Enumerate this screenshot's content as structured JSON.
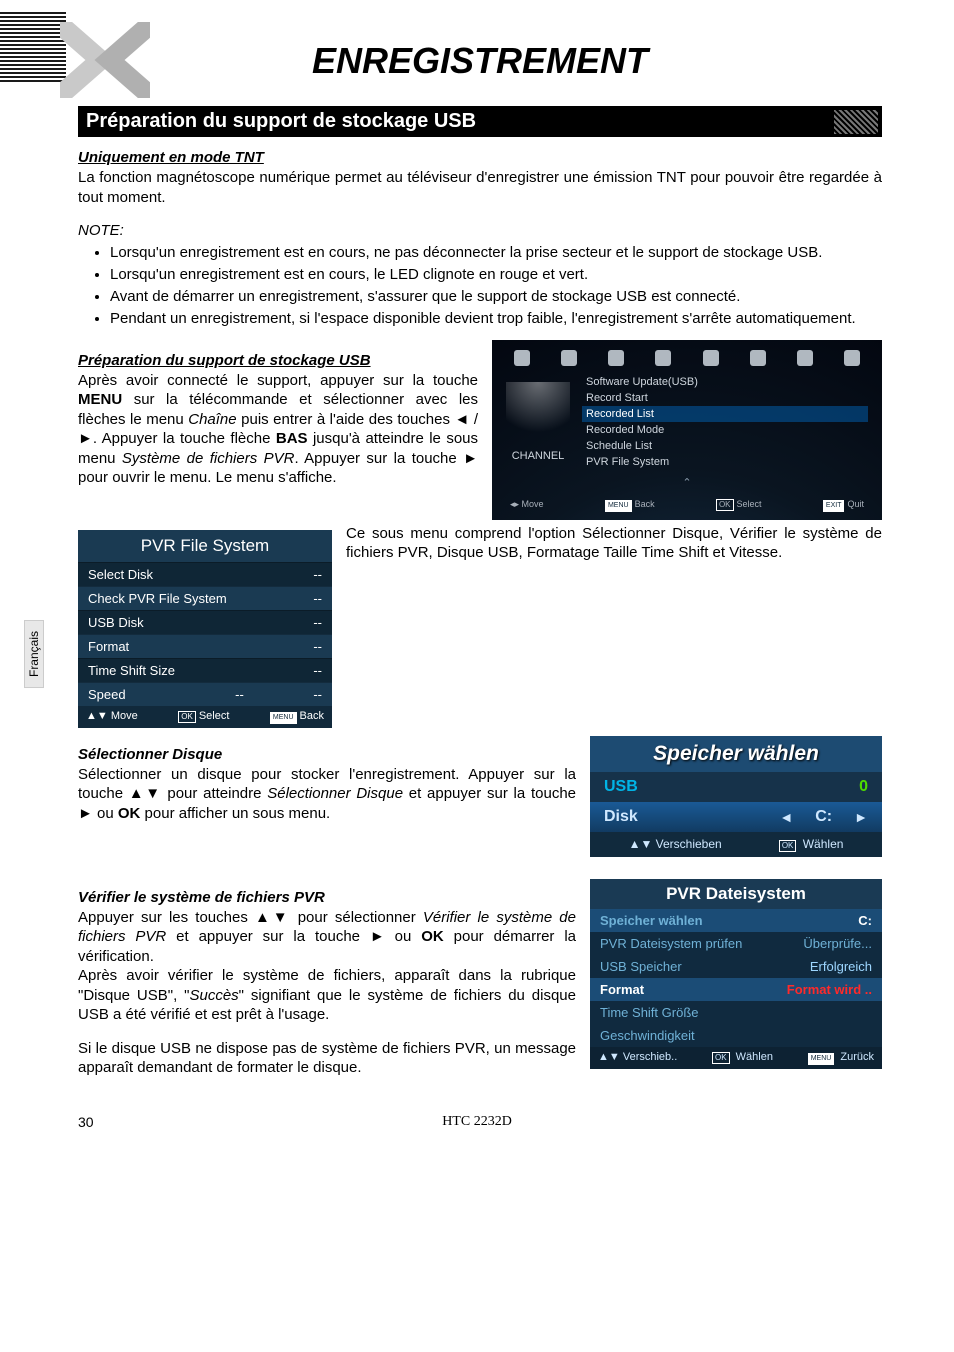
{
  "header": {
    "title": "ENREGISTREMENT"
  },
  "section": {
    "heading": "Préparation du support de stockage USB"
  },
  "side_tab": "Français",
  "sub1": {
    "heading": "Uniquement en mode TNT",
    "text": "La fonction magnétoscope numérique permet au téléviseur d'enregistrer une émission TNT pour pouvoir être regardée à tout moment."
  },
  "note_label": "NOTE:",
  "notes": [
    "Lorsqu'un enregistrement est en cours, ne pas déconnecter la prise secteur et le support de stockage USB.",
    "Lorsqu'un enregistrement est en cours, le LED clignote en rouge et vert.",
    "Avant de démarrer un enregistrement, s'assurer que le support de stockage USB est connecté.",
    "Pendant un enregistrement, si l'espace disponible devient trop faible, l'enregistrement s'arrête automatiquement."
  ],
  "prep": {
    "heading": "Préparation du support de stockage USB",
    "para_a": "Après avoir connecté le support, appuyer sur la touche ",
    "menu": "MENU",
    "para_b": " sur la télécommande et sélectionner avec les flèches le menu ",
    "chaine": "Chaîne",
    "para_c": " puis entrer à l'aide des touches ◄ / ►. Appuyer la touche flèche ",
    "bas": "BAS",
    "para_d": " jusqu'à atteindre le sous menu ",
    "syspvr": "Système de fichiers PVR",
    "para_e": ". Appuyer sur la touche ► pour ouvrir le menu. Le menu s'affiche."
  },
  "osd": {
    "channel": "CHANNEL",
    "items": [
      "Software Update(USB)",
      "Record Start",
      "Recorded List",
      "Recorded Mode",
      "Schedule List",
      "PVR File System"
    ],
    "highlight_index": 2,
    "footer": [
      "Move",
      "Back",
      "Select",
      "Quit"
    ]
  },
  "pvr_table": {
    "title": "PVR File System",
    "rows": [
      {
        "label": "Select Disk",
        "value": "--"
      },
      {
        "label": "Check PVR File System",
        "value": "--"
      },
      {
        "label": "USB Disk",
        "value": "--"
      },
      {
        "label": "Format",
        "value": "--"
      },
      {
        "label": "Time Shift Size",
        "value": "--"
      },
      {
        "label": "Speed",
        "value": "--"
      }
    ],
    "footer": {
      "move": "Move",
      "select": "Select",
      "back": "Back"
    }
  },
  "pvr_para": "Ce sous menu comprend l'option Sélectionner Disque, Vérifier le système de fichiers PVR, Disque USB, Formatage Taille Time Shift  et Vitesse.",
  "select_disk": {
    "heading": "Sélectionner Disque",
    "para_a": "Sélectionner un disque pour stocker l'enregistrement. Appuyer sur la touche ▲▼ pour atteindre ",
    "italic": "Sélectionner Disque",
    "para_b": " et appuyer sur la touche ► ou ",
    "ok": "OK",
    "para_c": " pour afficher un sous menu."
  },
  "speicher": {
    "title": "Speicher wählen",
    "usb_label": "USB",
    "usb_value": "0",
    "disk_label": "Disk",
    "disk_value": "C:",
    "footer_move": "Verschieben",
    "footer_select": "Wählen"
  },
  "verify": {
    "heading": "Vérifier le système de fichiers PVR",
    "para1_a": "Appuyer sur les touches ▲▼ pour sélectionner ",
    "para1_italic": "Vérifier le système de fichiers PVR",
    "para1_b": " et appuyer sur la touche ► ou ",
    "para1_ok": "OK",
    "para1_c": " pour démarrer la vérification.",
    "para2_a": "Après avoir vérifier le système de fichiers, apparaît dans la rubrique \"Disque USB\", \"",
    "para2_italic": "Succès",
    "para2_b": "\" signifiant que le système de fichiers du disque USB a été vérifié et est prêt à l'usage.",
    "para3": "Si le disque USB ne dispose pas de système de fichiers PVR, un message apparaît demandant de formater le disque."
  },
  "datei": {
    "title": "PVR Dateisystem",
    "rows": [
      {
        "label": "Speicher wählen",
        "value": "C:",
        "cls": "sel"
      },
      {
        "label": "PVR Dateisystem prüfen",
        "value": "Überprüfe...",
        "cls": ""
      },
      {
        "label": "USB Speicher",
        "value": "Erfolgreich",
        "cls": "erfolg"
      },
      {
        "label": "Format",
        "value": "Format wird ..",
        "cls": "format"
      },
      {
        "label": "Time Shift Größe",
        "value": "",
        "cls": ""
      },
      {
        "label": "Geschwindigkeit",
        "value": "",
        "cls": ""
      }
    ],
    "footer": {
      "move": "Verschieb..",
      "select": "Wählen",
      "back": "Zurück"
    }
  },
  "footer": {
    "page": "30",
    "model": "HTC 2232D"
  }
}
